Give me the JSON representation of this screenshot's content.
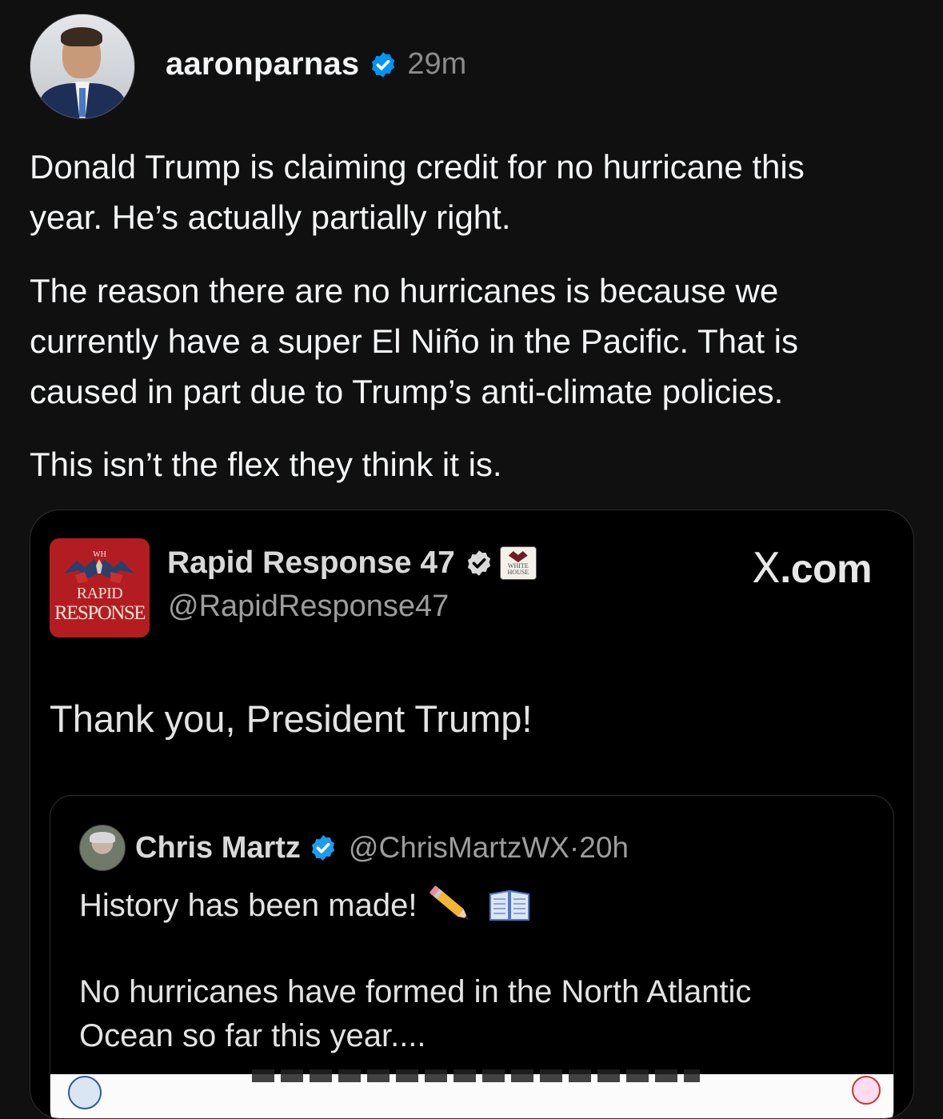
{
  "post": {
    "username": "aaronparnas",
    "time": "29m",
    "paragraphs": [
      "Donald Trump is claiming credit for no hurricane this\nyear. He’s actually partially right.",
      "The reason there are no hurricanes is because we\ncurrently have a super El Niño in the Pacific. That is\ncaused in part due to Trump’s anti-climate policies.",
      "This isn’t the flex they think it is."
    ]
  },
  "embed": {
    "logo": {
      "line0": "WH",
      "line1": "RAPID",
      "line2": "RESPONSE"
    },
    "name": "Rapid Response 47",
    "handle": "@RapidResponse47",
    "affiliation_badge": {
      "line1": "WHITE",
      "line2": "HOUSE"
    },
    "source": {
      "mark": "X",
      "suffix": ".com"
    },
    "text": "Thank you, President Trump!",
    "quote": {
      "name": "Chris Martz",
      "handle": "@ChrisMartzWX·20h",
      "line1": "History has been made!",
      "emoji": [
        "pencil-icon",
        "open-book-icon"
      ],
      "body": "No hurricanes have formed in the North Atlantic\nOcean so far this year...."
    }
  },
  "colors": {
    "background": "#101010",
    "verified": "#0095f6",
    "logo_red": "#b31d22"
  }
}
